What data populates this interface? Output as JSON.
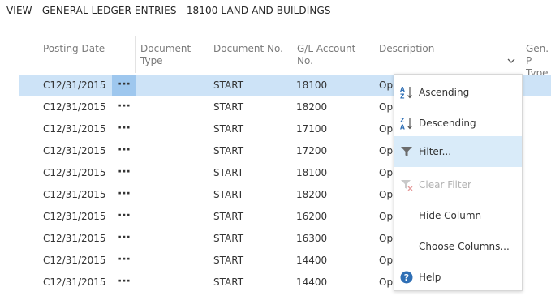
{
  "page": {
    "title": "VIEW - GENERAL LEDGER ENTRIES - 18100 LAND AND BUILDINGS"
  },
  "columns": {
    "posting_date": "Posting Date",
    "document_type_1": "Document",
    "document_type_2": "Type",
    "document_no": "Document No.",
    "gl_account_1": "G/L Account",
    "gl_account_2": "No.",
    "description": "Description",
    "gen_posting_1": "Gen. P",
    "gen_posting_2": "Type"
  },
  "row_menu_glyph": "···",
  "rows": [
    {
      "date": "C12/31/2015",
      "doc_no": "START",
      "account": "18100",
      "desc": "Op",
      "selected": true
    },
    {
      "date": "C12/31/2015",
      "doc_no": "START",
      "account": "18200",
      "desc": "Op"
    },
    {
      "date": "C12/31/2015",
      "doc_no": "START",
      "account": "17100",
      "desc": "Op"
    },
    {
      "date": "C12/31/2015",
      "doc_no": "START",
      "account": "17200",
      "desc": "Op"
    },
    {
      "date": "C12/31/2015",
      "doc_no": "START",
      "account": "18100",
      "desc": "Op"
    },
    {
      "date": "C12/31/2015",
      "doc_no": "START",
      "account": "18200",
      "desc": "Op"
    },
    {
      "date": "C12/31/2015",
      "doc_no": "START",
      "account": "16200",
      "desc": "Op"
    },
    {
      "date": "C12/31/2015",
      "doc_no": "START",
      "account": "16300",
      "desc": "Op"
    },
    {
      "date": "C12/31/2015",
      "doc_no": "START",
      "account": "14400",
      "desc": "Op"
    },
    {
      "date": "C12/31/2015",
      "doc_no": "START",
      "account": "14400",
      "desc": "Op"
    }
  ],
  "menu": {
    "items": [
      {
        "label": "Ascending",
        "icon": "sort-ascending-icon"
      },
      {
        "label": "Descending",
        "icon": "sort-descending-icon"
      },
      {
        "label": "Filter...",
        "icon": "filter-icon",
        "highlighted": true
      },
      {
        "label": "Clear Filter",
        "icon": "clear-filter-icon",
        "disabled": true
      },
      {
        "label": "Hide Column",
        "icon": ""
      },
      {
        "label": "Choose Columns...",
        "icon": ""
      },
      {
        "label": "Help",
        "icon": "help-icon"
      }
    ]
  },
  "colors": {
    "selected_row": "#cde3f7",
    "selected_dots": "#9ec7ee",
    "menu_highlight": "#d9ebf9",
    "accent_blue": "#2f6fb5"
  }
}
